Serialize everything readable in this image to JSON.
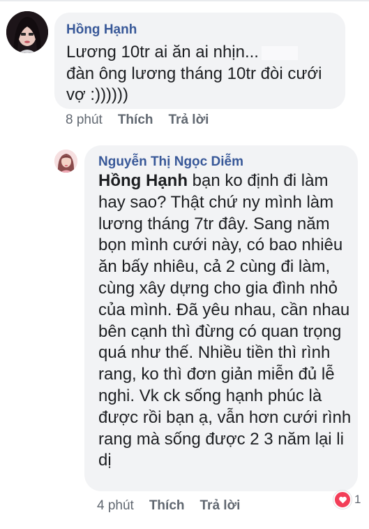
{
  "comments": [
    {
      "author": "Hồng Hạnh",
      "text_part1": "Lương 10tr ai ăn ai nhịn...",
      "text_part2": "đàn ông lương tháng 10tr đòi cưới vợ :))))))",
      "time": "8 phút",
      "like": "Thích",
      "reply": "Trả lời"
    },
    {
      "author": "Nguyễn Thị Ngọc Diễm",
      "mention": "Hồng Hạnh",
      "text": " bạn ko định đi làm hay sao? Thật chứ ny mình làm lương tháng 7tr đây. Sang năm bọn mình cưới này, có bao nhiêu ăn bấy nhiêu, cả 2 cùng đi làm, cùng xây dựng cho gia đình nhỏ của mình. Đã yêu nhau, cần nhau bên cạnh thì đừng có quan trọng quá như thế. Nhiều tiền thì rình rang, ko thì đơn giản miễn đủ lễ nghi. Vk ck sống hạnh phúc là được rồi bạn ạ, vẫn hơn cưới rình rang mà sống được 2 3 năm lại li dị",
      "time": "4 phút",
      "like": "Thích",
      "reply": "Trả lời",
      "reaction_count": "1",
      "reaction_icon": "heart-icon"
    }
  ],
  "colors": {
    "bubble": "#f2f3f5",
    "author": "#385898",
    "meta": "#606770",
    "heart": "#f33e58"
  }
}
